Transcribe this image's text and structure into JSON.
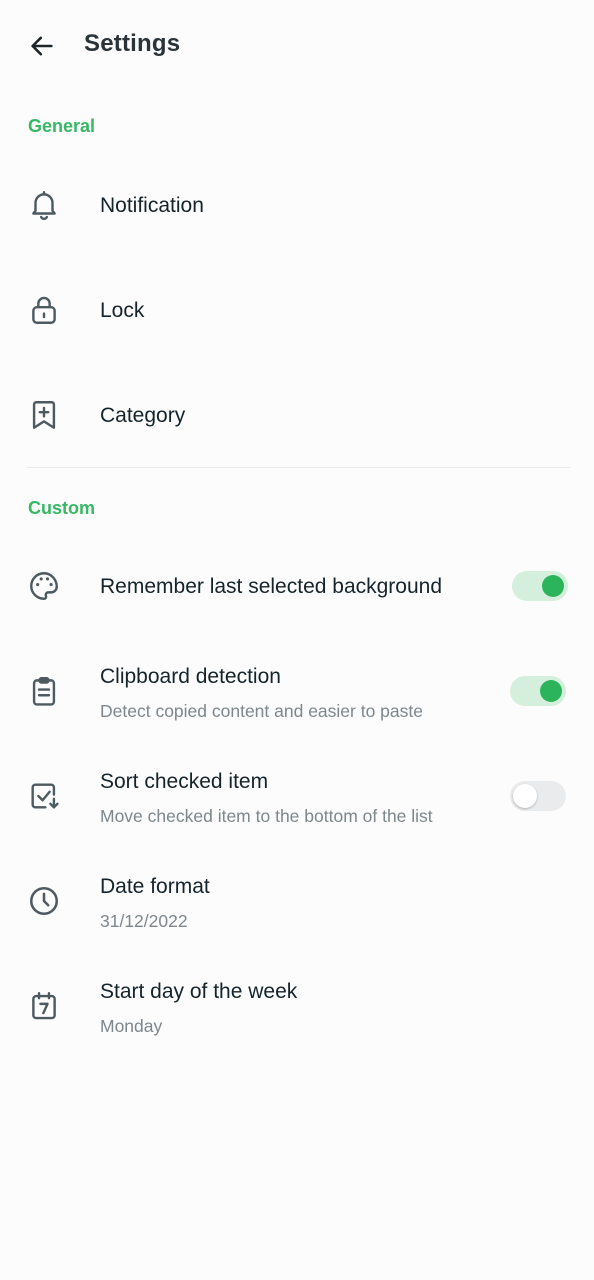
{
  "header": {
    "title": "Settings",
    "back_icon": "arrow-left-icon"
  },
  "sections": {
    "general": "General",
    "custom": "Custom"
  },
  "general_items": [
    {
      "label": "Notification",
      "icon": "bell-icon"
    },
    {
      "label": "Lock",
      "icon": "lock-icon"
    },
    {
      "label": "Category",
      "icon": "bookmark-plus-icon"
    }
  ],
  "custom_items": [
    {
      "label": "Remember last selected background",
      "icon": "palette-icon",
      "toggle": true
    },
    {
      "label": "Clipboard detection",
      "sub": "Detect copied content and easier to paste",
      "icon": "clipboard-icon",
      "toggle": true
    },
    {
      "label": "Sort checked item",
      "sub": "Move checked item to the bottom of the list",
      "icon": "checkbox-arrow-icon",
      "toggle": false
    },
    {
      "label": "Date format",
      "sub": "31/12/2022",
      "icon": "clock-icon"
    },
    {
      "label": "Start day of the week",
      "sub": "Monday",
      "icon": "calendar-7-icon"
    }
  ],
  "colors": {
    "accent": "#36b865",
    "switch_on": "#2cb45c",
    "text": "#15242b",
    "secondary": "#7d878c"
  }
}
